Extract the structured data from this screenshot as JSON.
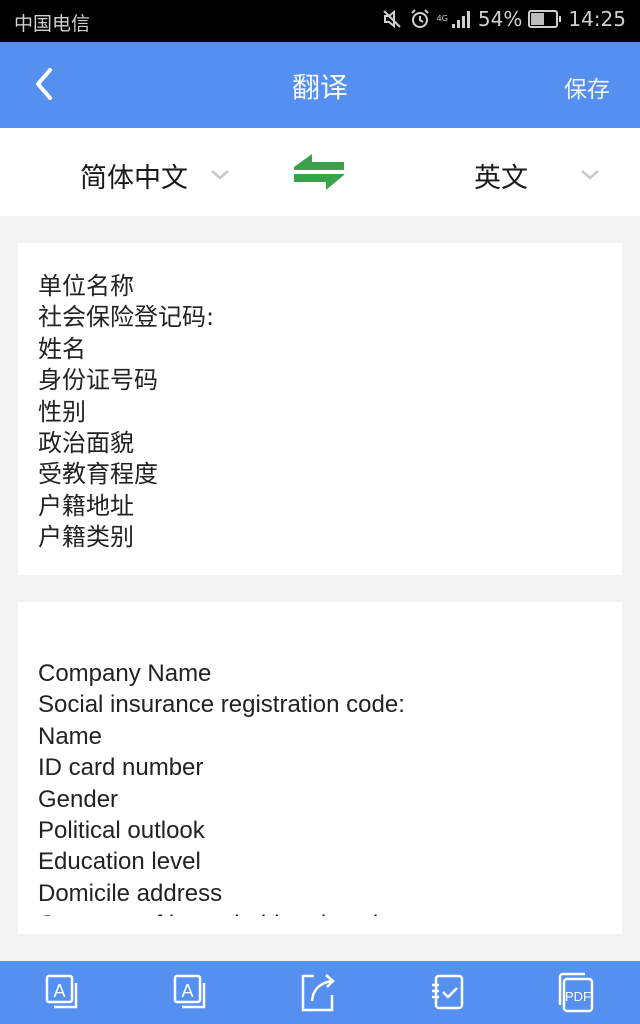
{
  "status_bar": {
    "carrier": "中国电信",
    "network_label": "4G",
    "battery_percent": "54%",
    "battery_level": 0.54,
    "time": "14:25",
    "icons": [
      "mute-icon",
      "alarm-icon",
      "signal-icon",
      "battery-icon"
    ]
  },
  "app_bar": {
    "back_icon": "chevron-left-icon",
    "title": "翻译",
    "save_label": "保存"
  },
  "language_bar": {
    "source_language": "简体中文",
    "target_language": "英文",
    "swap_icon": "swap-arrows-icon",
    "swap_color": "#3aa34a"
  },
  "source_text": {
    "lines": [
      "单位名称",
      "社会保险登记码:",
      "姓名",
      "身份证号码",
      "性别",
      "政治面貌",
      "受教育程度",
      "户籍地址",
      "户籍类别"
    ]
  },
  "translated_text": {
    "lines": [
      "Company Name",
      "Social insurance registration code:",
      "Name",
      "ID card number",
      "Gender",
      "Political outlook",
      "Education level",
      "Domicile address",
      "Category of household registration"
    ]
  },
  "bottom_toolbar": {
    "items": [
      {
        "icon": "copy-source-text-icon"
      },
      {
        "icon": "copy-translation-icon"
      },
      {
        "icon": "share-icon"
      },
      {
        "icon": "notebook-check-icon"
      },
      {
        "icon": "pdf-icon",
        "label": "PDF"
      }
    ]
  },
  "colors": {
    "primary": "#5590f0",
    "status_bar": "#000000",
    "background": "#f3f3f3"
  }
}
